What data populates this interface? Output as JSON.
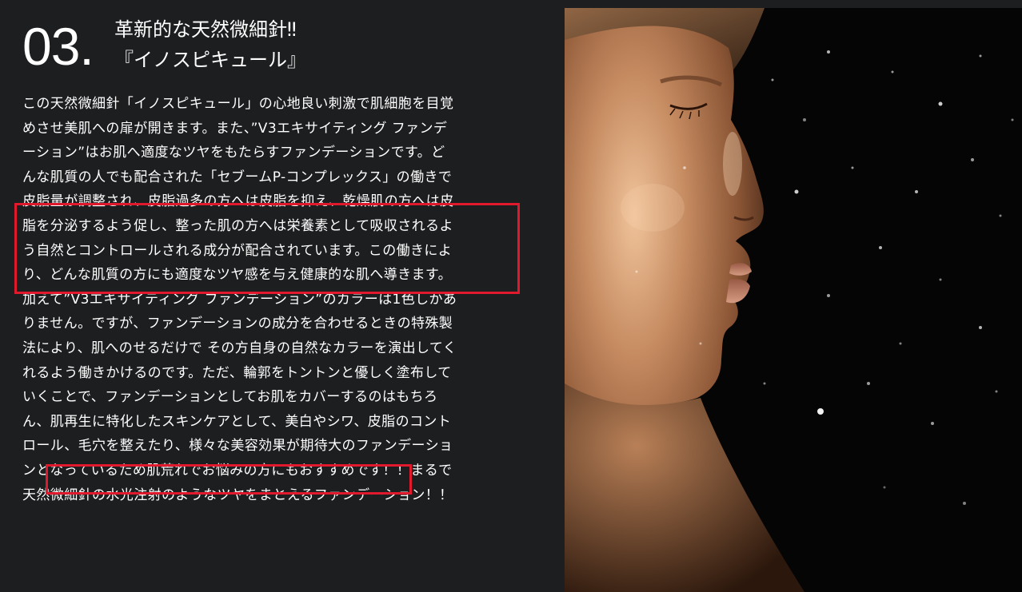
{
  "section": {
    "number": "03.",
    "heading_lines": [
      "革新的な天然微細針‼",
      "『イノスピキュール』"
    ]
  },
  "body": {
    "lines": [
      "この天然微細針「イノスピキュール」の心地良い刺激で肌細胞を目覚",
      "めさせ美肌への扉が開きます。また、”V3エキサイティング ファンデ",
      "ーション”はお肌へ適度なツヤをもたらすファンデーションです。ど",
      "んな肌質の人でも配合された「セブームP-コンプレックス」の働きで",
      "皮脂量が調整され、皮脂過多の方へは皮脂を抑え、乾燥肌の方へは皮",
      "脂を分泌するよう促し、整った肌の方へは栄養素として吸収されるよ",
      "う自然とコントロールされる成分が配合されています。この働きによ",
      "り、どんな肌質の方にも適度なツヤ感を与え健康的な肌へ導きます。",
      "加えて”V3エキサイティング ファンデーション”のカラーは1色しかあ",
      "りません。ですが、ファンデーションの成分を合わせるときの特殊製",
      "法により、肌へのせるだけで その方自身の自然なカラーを演出してく",
      "れるよう働きかけるのです。ただ、輪郭をトントンと優しく塗布して",
      "いくことで、ファンデーションとしてお肌をカバーするのはもちろ",
      "ん、肌再生に特化したスキンケアとして、美白やシワ、皮脂のコント",
      "ロール、毛穴を整えたり、様々な美容効果が期待大のファンデーショ",
      "ンとなっているため肌荒れでお悩みの方にもおすすめです！！まるで",
      "天然微細針の水光注射のようなツヤをまとえるファンデーション！！"
    ]
  },
  "colors": {
    "background": "#1d1e20",
    "text": "#ffffff",
    "highlight_border": "#e0192d",
    "photo_background": "#050505",
    "skin_tone": "#b07a55"
  },
  "photo": {
    "subject": "woman-profile-with-water-droplets"
  }
}
